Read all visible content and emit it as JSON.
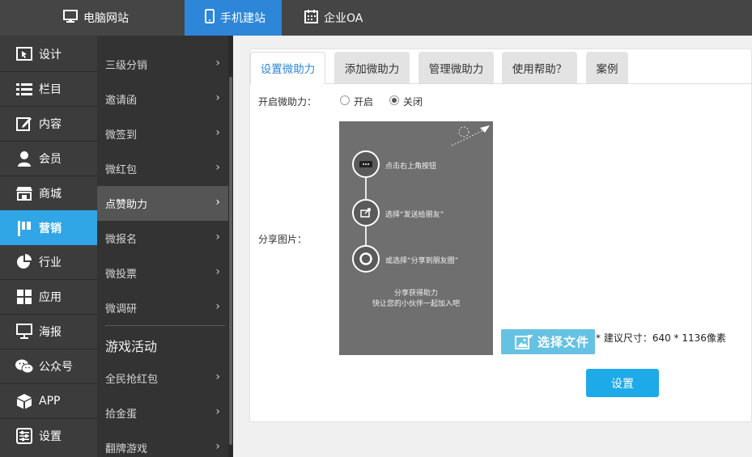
{
  "topbar": {
    "tabs": [
      {
        "label": "电脑网站",
        "icon": "monitor-icon"
      },
      {
        "label": "手机建站",
        "icon": "phone-icon",
        "active": true
      },
      {
        "label": "企业OA",
        "icon": "calendar-icon"
      }
    ]
  },
  "sidebar": {
    "items": [
      {
        "label": "设计",
        "icon": "design-icon"
      },
      {
        "label": "栏目",
        "icon": "list-icon"
      },
      {
        "label": "内容",
        "icon": "edit-icon"
      },
      {
        "label": "会员",
        "icon": "user-icon"
      },
      {
        "label": "商城",
        "icon": "store-icon"
      },
      {
        "label": "营销",
        "icon": "flag-icon",
        "active": true
      },
      {
        "label": "行业",
        "icon": "pie-icon"
      },
      {
        "label": "应用",
        "icon": "grid-icon"
      },
      {
        "label": "海报",
        "icon": "easel-icon"
      },
      {
        "label": "公众号",
        "icon": "wechat-icon"
      },
      {
        "label": "APP",
        "icon": "cube-icon"
      },
      {
        "label": "设置",
        "icon": "sliders-icon"
      }
    ]
  },
  "subnav": {
    "items": [
      {
        "label": "三级分销"
      },
      {
        "label": "邀请函"
      },
      {
        "label": "微签到"
      },
      {
        "label": "微红包"
      },
      {
        "label": "点赞助力",
        "active": true
      },
      {
        "label": "微报名"
      },
      {
        "label": "微投票"
      },
      {
        "label": "微调研"
      }
    ],
    "section_title": "游戏活动",
    "game_items": [
      {
        "label": "全民抢红包"
      },
      {
        "label": "拾金蛋"
      },
      {
        "label": "翻牌游戏"
      }
    ]
  },
  "tabs": [
    {
      "label": "设置微助力",
      "active": true
    },
    {
      "label": "添加微助力"
    },
    {
      "label": "管理微助力"
    },
    {
      "label": "使用帮助？"
    },
    {
      "label": "案例"
    }
  ],
  "form": {
    "enable_label": "开启微助力：",
    "option_on": "开启",
    "option_off": "关闭",
    "selected": "关闭",
    "share_image_label": "分享图片：",
    "preview": {
      "step1": "点击右上角按钮",
      "step2": "选择“发送给朋友”",
      "step3": "或选择“分享到朋友圈”",
      "line1": "分享获得助力",
      "line2": "快让您的小伙伴一起加入吧"
    },
    "choose_file": "选择文件",
    "size_hint": "* 建议尺寸：640 * 1136像素",
    "submit": "设置"
  }
}
